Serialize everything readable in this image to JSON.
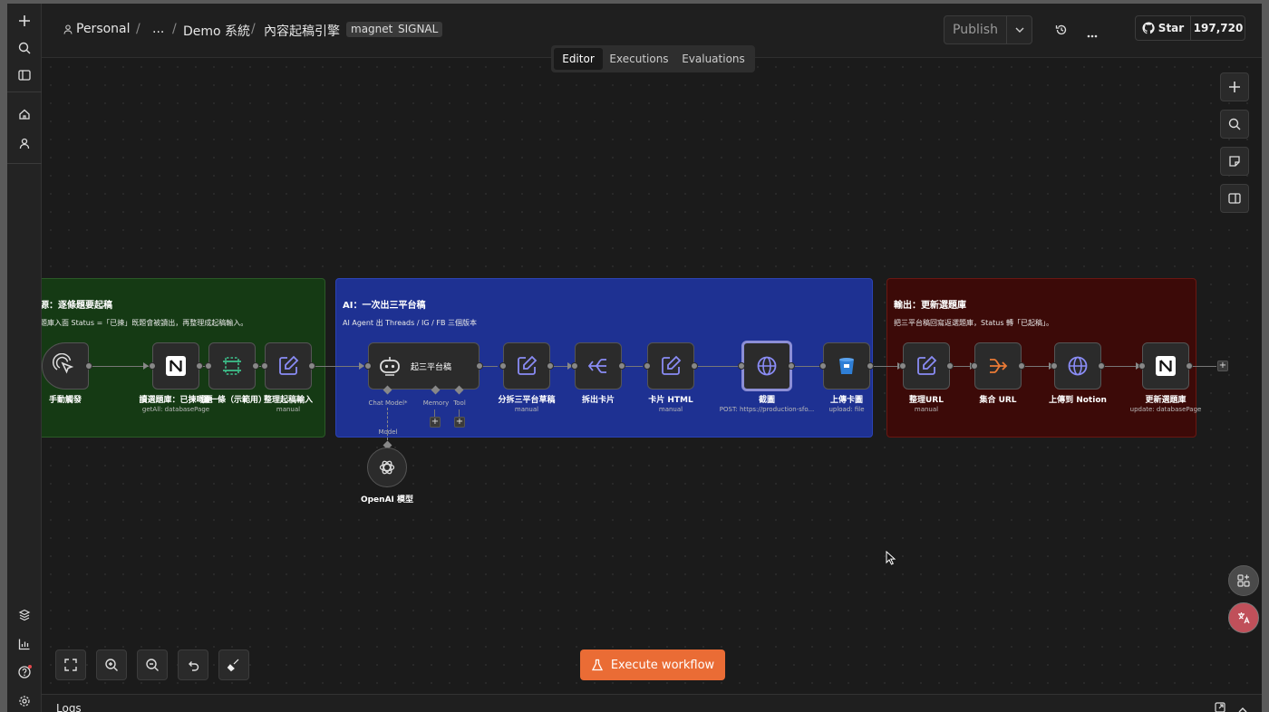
{
  "breadcrumb": {
    "workspace": "Personal",
    "ellipsis": "...",
    "project": "Demo 系統",
    "workflow": "內容起稿引擎"
  },
  "tags": [
    "magnet",
    "SIGNAL"
  ],
  "header": {
    "publish_label": "Publish",
    "star_label": "Star",
    "star_count": "197,720"
  },
  "tabs": [
    "Editor",
    "Executions",
    "Evaluations"
  ],
  "stickies": {
    "source": {
      "title": "源：逐條題要起稿",
      "desc": "題庫入面 Status =「已揀」既題會被讀出，再整理成起稿輸入。"
    },
    "ai": {
      "title": "AI：一次出三平台稿",
      "desc": "AI Agent 出 Threads / IG / FB 三個版本"
    },
    "output": {
      "title": "輸出：更新選題庫",
      "desc": "把三平台稿回寫返選題庫，Status 轉「已起稿」。"
    }
  },
  "nodes": {
    "manual_trigger": {
      "label": "手動觸發",
      "sub": ""
    },
    "read_db": {
      "label": "讀選題庫：已揀嘅題",
      "sub": "getAll: databasePage"
    },
    "limit": {
      "label": "攞一條（示範用）",
      "sub": ""
    },
    "prep_input": {
      "label": "整理起稿輸入",
      "sub": "manual"
    },
    "agent": {
      "label": "起三平台稿",
      "sub": ""
    },
    "split_drafts": {
      "label": "分拆三平台草稿",
      "sub": "manual"
    },
    "split_cards": {
      "label": "拆出卡片",
      "sub": ""
    },
    "card_html": {
      "label": "卡片 HTML",
      "sub": "manual"
    },
    "screenshot": {
      "label": "截圖",
      "sub": "POST: https://production-sfo..."
    },
    "upload_card": {
      "label": "上傳卡圖",
      "sub": "upload: file"
    },
    "tidy_url": {
      "label": "整理URL",
      "sub": "manual"
    },
    "aggregate_url": {
      "label": "集合 URL",
      "sub": ""
    },
    "upload_notion": {
      "label": "上傳到 Notion",
      "sub": ""
    },
    "update_db": {
      "label": "更新選題庫",
      "sub": "update: databasePage"
    },
    "openai_model": {
      "label": "OpenAI 模型",
      "sub": ""
    }
  },
  "agent_ports": {
    "chat_model": "Chat Model*",
    "memory": "Memory",
    "tool": "Tool",
    "model": "Model"
  },
  "canvas_controls": {
    "execute_label": "Execute workflow"
  },
  "logs": {
    "title": "Logs"
  },
  "colors": {
    "accent": "#ea6c35",
    "source_sticky": "#153a14",
    "ai_sticky": "#1e3192",
    "output_sticky": "#3c0a08"
  },
  "icons": {
    "rail": [
      "plus-icon",
      "search-icon",
      "sidebar-icon",
      "home-icon",
      "user-icon",
      "templates-icon",
      "insights-icon",
      "help-icon",
      "settings-icon"
    ]
  }
}
